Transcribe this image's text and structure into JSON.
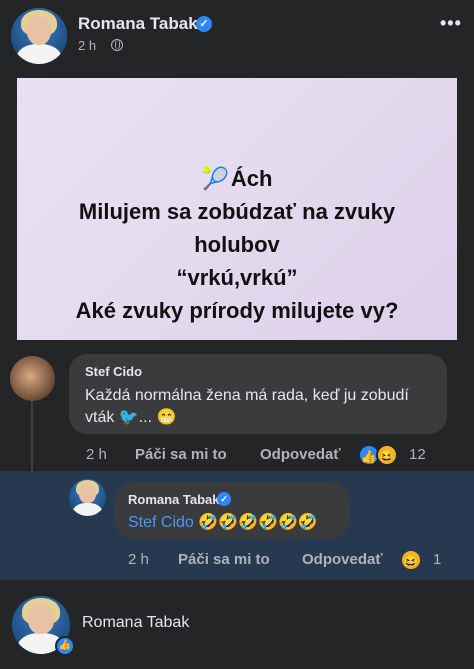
{
  "post": {
    "author": "Romana Tabak",
    "time": "2 h",
    "image_text": {
      "line1": "Ách",
      "line2": "Milujem sa zobúdzať na zvuky",
      "line3": "holubov",
      "line4": "“vrkú,vrkú”",
      "line5": "Aké zvuky prírody milujete vy?"
    }
  },
  "comments": [
    {
      "author": "Stef Cido",
      "text": "Každá normálna žena má rada,  keď ju zobudí vták 🐦... 😁",
      "time": "2 h",
      "like_label": "Páči sa mi to",
      "reply_label": "Odpovedať",
      "reaction_count": "12",
      "reactions": [
        "like-icon",
        "haha-icon"
      ]
    }
  ],
  "reply": {
    "author": "Romana Tabak",
    "mention": "Stef Cido",
    "emojis": "🤣🤣🤣🤣🤣🤣",
    "time": "2 h",
    "like_label": "Páči sa mi to",
    "reply_label": "Odpovedať",
    "reaction_count": "1"
  },
  "composer": {
    "name": "Romana Tabak"
  },
  "colors": {
    "background": "#242526",
    "bubble": "#3a3b3c",
    "highlight": "#263951",
    "accent": "#2d88ff",
    "secondary_text": "#b0b3b8"
  }
}
